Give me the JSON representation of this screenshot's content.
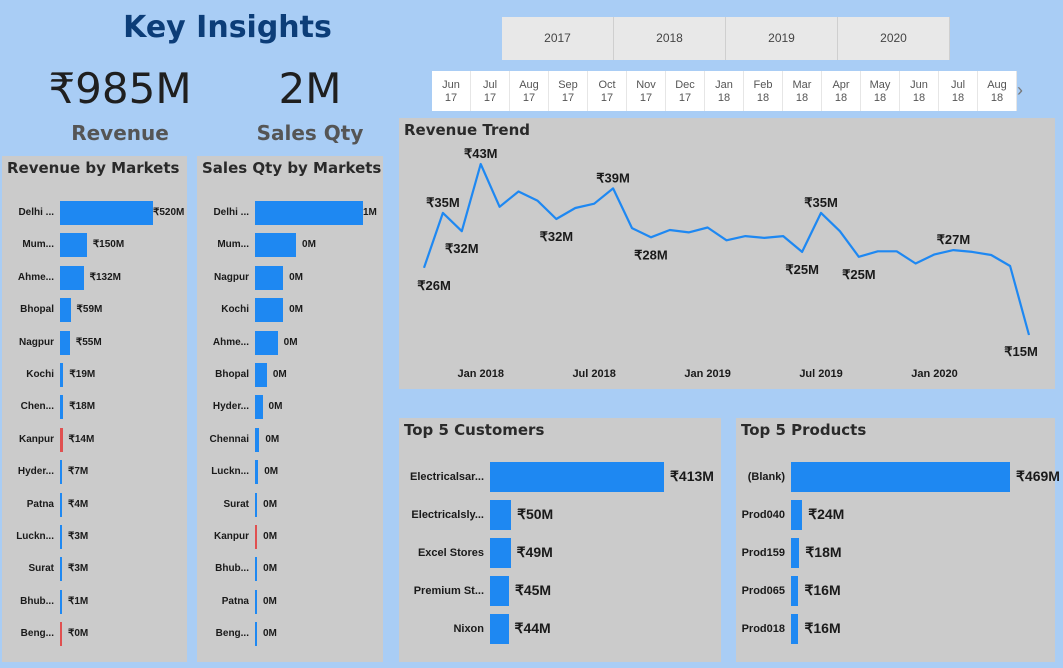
{
  "header": {
    "title": "Key Insights"
  },
  "kpis": {
    "revenue": {
      "value": "₹985M",
      "label": "Revenue"
    },
    "sales_qty": {
      "value": "2M",
      "label": "Sales Qty"
    }
  },
  "year_slicer": [
    "2017",
    "2018",
    "2019",
    "2020"
  ],
  "month_slicer": [
    {
      "m": "Jun",
      "y": "17"
    },
    {
      "m": "Jul",
      "y": "17"
    },
    {
      "m": "Aug",
      "y": "17"
    },
    {
      "m": "Sep",
      "y": "17"
    },
    {
      "m": "Oct",
      "y": "17"
    },
    {
      "m": "Nov",
      "y": "17"
    },
    {
      "m": "Dec",
      "y": "17"
    },
    {
      "m": "Jan",
      "y": "18"
    },
    {
      "m": "Feb",
      "y": "18"
    },
    {
      "m": "Mar",
      "y": "18"
    },
    {
      "m": "Apr",
      "y": "18"
    },
    {
      "m": "May",
      "y": "18"
    },
    {
      "m": "Jun",
      "y": "18"
    },
    {
      "m": "Jul",
      "y": "18"
    },
    {
      "m": "Aug",
      "y": "18"
    }
  ],
  "month_scroll_icon": "chevron-right-icon",
  "colors": {
    "bar": "#1e88f2",
    "negative": "#e05050",
    "line": "#1e88f2",
    "panel": "#cbcbcb",
    "background": "#a9cdf5",
    "title": "#0c3d78"
  },
  "revenue_by_markets": {
    "title": "Revenue by Markets",
    "rows": [
      {
        "label": "Delhi ...",
        "value": 520,
        "display": "₹520M"
      },
      {
        "label": "Mum...",
        "value": 150,
        "display": "₹150M"
      },
      {
        "label": "Ahme...",
        "value": 132,
        "display": "₹132M"
      },
      {
        "label": "Bhopal",
        "value": 59,
        "display": "₹59M"
      },
      {
        "label": "Nagpur",
        "value": 55,
        "display": "₹55M"
      },
      {
        "label": "Kochi",
        "value": 19,
        "display": "₹19M"
      },
      {
        "label": "Chen...",
        "value": 18,
        "display": "₹18M"
      },
      {
        "label": "Kanpur",
        "value": 14,
        "display": "₹14M",
        "negative": true
      },
      {
        "label": "Hyder...",
        "value": 7,
        "display": "₹7M"
      },
      {
        "label": "Patna",
        "value": 4,
        "display": "₹4M"
      },
      {
        "label": "Luckn...",
        "value": 3,
        "display": "₹3M"
      },
      {
        "label": "Surat",
        "value": 3,
        "display": "₹3M"
      },
      {
        "label": "Bhub...",
        "value": 1,
        "display": "₹1M"
      },
      {
        "label": "Beng...",
        "value": 0,
        "display": "₹0M",
        "negative": true
      }
    ]
  },
  "sales_qty_by_markets": {
    "title": "Sales Qty by Markets",
    "rows": [
      {
        "label": "Delhi ...",
        "value": 1.0,
        "display": "1M"
      },
      {
        "label": "Mum...",
        "value": 0.38,
        "display": "0M"
      },
      {
        "label": "Nagpur",
        "value": 0.26,
        "display": "0M"
      },
      {
        "label": "Kochi",
        "value": 0.26,
        "display": "0M"
      },
      {
        "label": "Ahme...",
        "value": 0.21,
        "display": "0M"
      },
      {
        "label": "Bhopal",
        "value": 0.11,
        "display": "0M"
      },
      {
        "label": "Hyder...",
        "value": 0.07,
        "display": "0M"
      },
      {
        "label": "Chennai",
        "value": 0.04,
        "display": "0M"
      },
      {
        "label": "Luckn...",
        "value": 0.03,
        "display": "0M"
      },
      {
        "label": "Surat",
        "value": 0.02,
        "display": "0M"
      },
      {
        "label": "Kanpur",
        "value": 0.02,
        "display": "0M",
        "negative": true
      },
      {
        "label": "Bhub...",
        "value": 0.02,
        "display": "0M"
      },
      {
        "label": "Patna",
        "value": 0.01,
        "display": "0M"
      },
      {
        "label": "Beng...",
        "value": 0.01,
        "display": "0M"
      }
    ]
  },
  "top_customers": {
    "title": "Top 5 Customers",
    "rows": [
      {
        "label": "Electricalsar...",
        "value": 413,
        "display": "₹413M"
      },
      {
        "label": "Electricalsly...",
        "value": 50,
        "display": "₹50M"
      },
      {
        "label": "Excel Stores",
        "value": 49,
        "display": "₹49M"
      },
      {
        "label": "Premium St...",
        "value": 45,
        "display": "₹45M"
      },
      {
        "label": "Nixon",
        "value": 44,
        "display": "₹44M"
      }
    ]
  },
  "top_products": {
    "title": "Top 5 Products",
    "rows": [
      {
        "label": "(Blank)",
        "value": 469,
        "display": "₹469M"
      },
      {
        "label": "Prod040",
        "value": 24,
        "display": "₹24M"
      },
      {
        "label": "Prod159",
        "value": 18,
        "display": "₹18M"
      },
      {
        "label": "Prod065",
        "value": 16,
        "display": "₹16M"
      },
      {
        "label": "Prod018",
        "value": 16,
        "display": "₹16M"
      }
    ]
  },
  "chart_data": {
    "type": "line",
    "title": "Revenue Trend",
    "x_tick_labels": [
      "Jan 2018",
      "Jul 2018",
      "Jan 2019",
      "Jul 2019",
      "Jan 2020"
    ],
    "x": [
      "2017-10",
      "2017-11",
      "2017-12",
      "2018-01",
      "2018-02",
      "2018-03",
      "2018-04",
      "2018-05",
      "2018-06",
      "2018-07",
      "2018-08",
      "2018-09",
      "2018-10",
      "2018-11",
      "2018-12",
      "2019-01",
      "2019-02",
      "2019-03",
      "2019-04",
      "2019-05",
      "2019-06",
      "2019-07",
      "2019-08",
      "2019-09",
      "2019-10",
      "2019-11",
      "2019-12",
      "2020-01",
      "2020-02",
      "2020-03",
      "2020-04",
      "2020-05",
      "2020-06"
    ],
    "series": [
      {
        "values": [
          26,
          35,
          32,
          43,
          36,
          38.5,
          37,
          34,
          35.8,
          36.5,
          39,
          32.5,
          31,
          32.2,
          31.8,
          32.6,
          30.5,
          31.2,
          30.9,
          31.2,
          28.6,
          35,
          32,
          27.8,
          28.7,
          28.7,
          26.7,
          28.2,
          28.9,
          28.6,
          28.1,
          26.3,
          15
        ],
        "labels": {
          "0": "₹26M",
          "1": "₹35M",
          "2": "₹32M",
          "3": "₹43M",
          "7": "₹32M",
          "10": "₹39M",
          "12": "₹28M",
          "20": "₹25M",
          "21": "₹35M",
          "23": "₹25M",
          "28": "₹27M",
          "32": "₹15M"
        }
      }
    ],
    "grid": false
  }
}
